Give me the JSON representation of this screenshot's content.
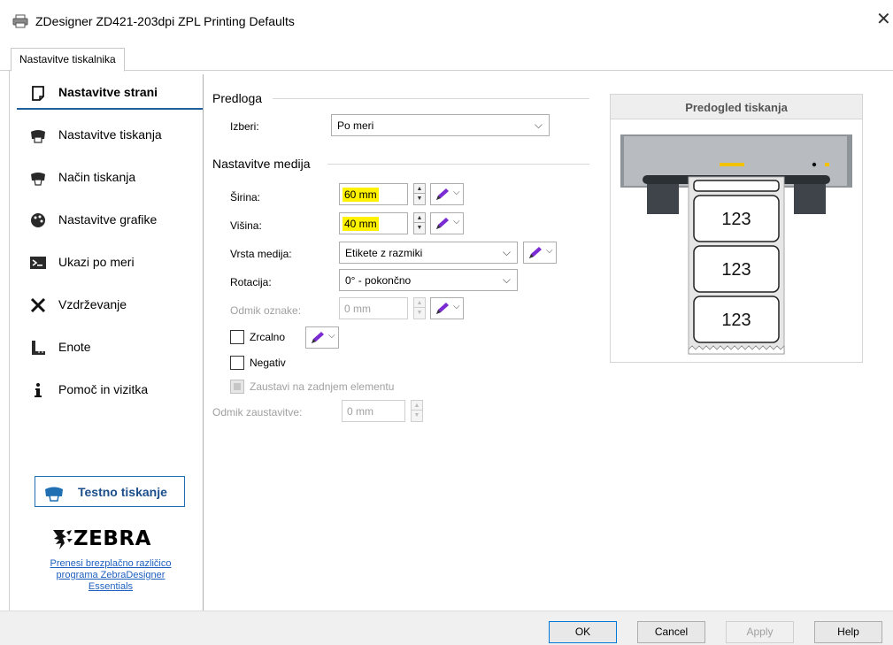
{
  "window": {
    "title": "ZDesigner ZD421-203dpi ZPL Printing Defaults",
    "close_glyph": "✕",
    "icon": "printer-icon"
  },
  "tabs": [
    {
      "label": "Nastavitve tiskalnika",
      "active": true
    }
  ],
  "sidebar": {
    "items": [
      {
        "label": "Nastavitve strani",
        "icon": "page-icon",
        "active": true
      },
      {
        "label": "Nastavitve tiskanja",
        "icon": "printer-icon"
      },
      {
        "label": "Način tiskanja",
        "icon": "print-mode-icon"
      },
      {
        "label": "Nastavitve grafike",
        "icon": "palette-icon"
      },
      {
        "label": "Ukazi po meri",
        "icon": "command-prompt-icon"
      },
      {
        "label": "Vzdrževanje",
        "icon": "tools-icon"
      },
      {
        "label": "Enote",
        "icon": "ruler-icon"
      },
      {
        "label": "Pomoč in vizitka",
        "icon": "info-icon"
      }
    ],
    "test_print_label": "Testno tiskanje",
    "logo_text": "ZEBRA",
    "free_link": [
      "Prenesi brezplačno različico",
      "programa ZebraDesigner",
      "Essentials"
    ]
  },
  "template_group": {
    "title": "Predloga",
    "select_label": "Izberi:",
    "select_value": "Po meri",
    "dropdown_glyph": "⌵"
  },
  "media_group": {
    "title": "Nastavitve medija",
    "width_label": "Širina:",
    "width_value": "60 mm",
    "height_label": "Višina:",
    "height_value": "40 mm",
    "media_type_label": "Vrsta medija:",
    "media_type_value": "Etikete z razmiki",
    "rotation_label": "Rotacija:",
    "rotation_value": "0° - pokončno",
    "label_offset_label": "Odmik oznake:",
    "label_offset_value": "0 mm",
    "mirror_label": "Zrcalno",
    "negative_label": "Negativ",
    "stop_last_label": "Zaustavi na zadnjem elementu",
    "stop_offset_label": "Odmik zaustavitve:",
    "stop_offset_value": "0 mm"
  },
  "preview": {
    "title": "Predogled tiskanja",
    "label_texts": [
      "123",
      "123",
      "123"
    ]
  },
  "footer": {
    "ok": "OK",
    "cancel": "Cancel",
    "apply": "Apply",
    "help": "Help"
  },
  "colors": {
    "highlight": "#fff200",
    "accent": "#1f5f9b",
    "link": "#1d5fbf",
    "pen": "#7a2bd1"
  }
}
